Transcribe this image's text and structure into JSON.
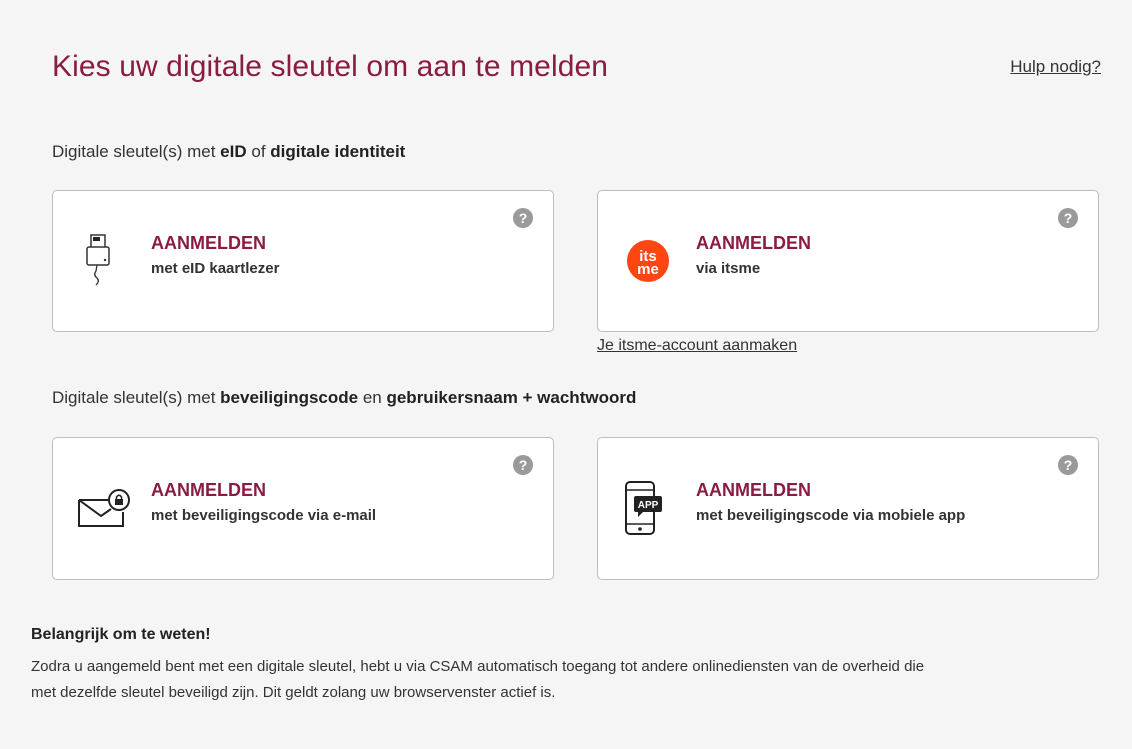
{
  "header": {
    "title": "Kies uw digitale sleutel om aan te melden",
    "help_link": "Hulp nodig?"
  },
  "section_eid": {
    "prefix": "Digitale sleutel(s) met ",
    "bold1": "eID",
    "middle": " of ",
    "bold2": "digitale identiteit"
  },
  "section_code": {
    "prefix": "Digitale sleutel(s) met ",
    "bold1": "beveiligingscode",
    "middle": " en ",
    "bold2": "gebruikersnaam + wachtwoord"
  },
  "cards": {
    "eid": {
      "title": "AANMELDEN",
      "subtitle": "met eID kaartlezer",
      "icon": "card-reader-icon"
    },
    "itsme": {
      "title": "AANMELDEN",
      "subtitle": "via itsme",
      "icon": "itsme-logo",
      "logo_top": "its",
      "logo_bottom": "me"
    },
    "mail": {
      "title": "AANMELDEN",
      "subtitle": "met beveiligingscode via e-mail",
      "icon": "secure-mail-icon"
    },
    "app": {
      "title": "AANMELDEN",
      "subtitle": "met beveiligingscode via mobiele app",
      "icon": "mobile-app-icon",
      "badge": "APP"
    },
    "help_glyph": "?"
  },
  "itsme_create_link": "Je itsme-account aanmaken",
  "important": {
    "title": "Belangrijk om te weten!",
    "text": "Zodra u aangemeld bent met een digitale sleutel, hebt u via CSAM automatisch toegang tot andere onlinediensten van de overheid die met dezelfde sleutel beveiligd zijn. Dit geldt zolang uw browservenster actief is."
  },
  "colors": {
    "accent": "#8a1c44",
    "itsme": "#ff4612",
    "help_icon": "#9a9a9a",
    "panel_bg": "#f5f5f5"
  }
}
